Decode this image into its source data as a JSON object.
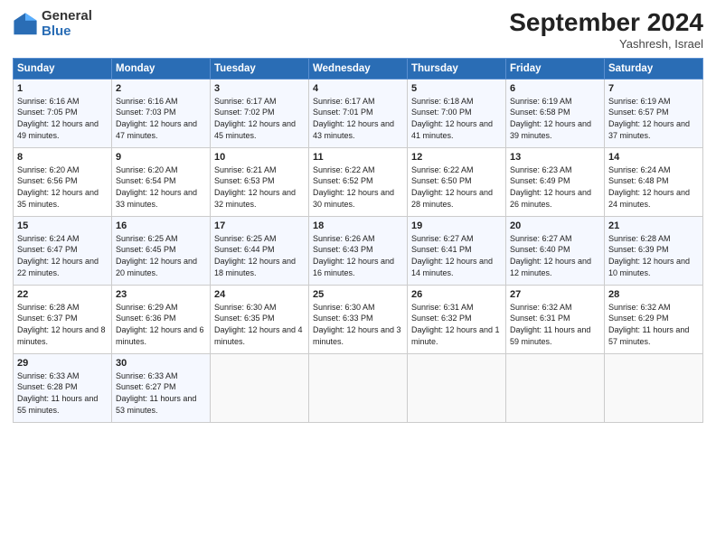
{
  "logo": {
    "general": "General",
    "blue": "Blue"
  },
  "header": {
    "month": "September 2024",
    "location": "Yashresh, Israel"
  },
  "days_of_week": [
    "Sunday",
    "Monday",
    "Tuesday",
    "Wednesday",
    "Thursday",
    "Friday",
    "Saturday"
  ],
  "weeks": [
    [
      {
        "day": "1",
        "sunrise": "6:16 AM",
        "sunset": "7:05 PM",
        "daylight": "12 hours and 49 minutes."
      },
      {
        "day": "2",
        "sunrise": "6:16 AM",
        "sunset": "7:03 PM",
        "daylight": "12 hours and 47 minutes."
      },
      {
        "day": "3",
        "sunrise": "6:17 AM",
        "sunset": "7:02 PM",
        "daylight": "12 hours and 45 minutes."
      },
      {
        "day": "4",
        "sunrise": "6:17 AM",
        "sunset": "7:01 PM",
        "daylight": "12 hours and 43 minutes."
      },
      {
        "day": "5",
        "sunrise": "6:18 AM",
        "sunset": "7:00 PM",
        "daylight": "12 hours and 41 minutes."
      },
      {
        "day": "6",
        "sunrise": "6:19 AM",
        "sunset": "6:58 PM",
        "daylight": "12 hours and 39 minutes."
      },
      {
        "day": "7",
        "sunrise": "6:19 AM",
        "sunset": "6:57 PM",
        "daylight": "12 hours and 37 minutes."
      }
    ],
    [
      {
        "day": "8",
        "sunrise": "6:20 AM",
        "sunset": "6:56 PM",
        "daylight": "12 hours and 35 minutes."
      },
      {
        "day": "9",
        "sunrise": "6:20 AM",
        "sunset": "6:54 PM",
        "daylight": "12 hours and 33 minutes."
      },
      {
        "day": "10",
        "sunrise": "6:21 AM",
        "sunset": "6:53 PM",
        "daylight": "12 hours and 32 minutes."
      },
      {
        "day": "11",
        "sunrise": "6:22 AM",
        "sunset": "6:52 PM",
        "daylight": "12 hours and 30 minutes."
      },
      {
        "day": "12",
        "sunrise": "6:22 AM",
        "sunset": "6:50 PM",
        "daylight": "12 hours and 28 minutes."
      },
      {
        "day": "13",
        "sunrise": "6:23 AM",
        "sunset": "6:49 PM",
        "daylight": "12 hours and 26 minutes."
      },
      {
        "day": "14",
        "sunrise": "6:24 AM",
        "sunset": "6:48 PM",
        "daylight": "12 hours and 24 minutes."
      }
    ],
    [
      {
        "day": "15",
        "sunrise": "6:24 AM",
        "sunset": "6:47 PM",
        "daylight": "12 hours and 22 minutes."
      },
      {
        "day": "16",
        "sunrise": "6:25 AM",
        "sunset": "6:45 PM",
        "daylight": "12 hours and 20 minutes."
      },
      {
        "day": "17",
        "sunrise": "6:25 AM",
        "sunset": "6:44 PM",
        "daylight": "12 hours and 18 minutes."
      },
      {
        "day": "18",
        "sunrise": "6:26 AM",
        "sunset": "6:43 PM",
        "daylight": "12 hours and 16 minutes."
      },
      {
        "day": "19",
        "sunrise": "6:27 AM",
        "sunset": "6:41 PM",
        "daylight": "12 hours and 14 minutes."
      },
      {
        "day": "20",
        "sunrise": "6:27 AM",
        "sunset": "6:40 PM",
        "daylight": "12 hours and 12 minutes."
      },
      {
        "day": "21",
        "sunrise": "6:28 AM",
        "sunset": "6:39 PM",
        "daylight": "12 hours and 10 minutes."
      }
    ],
    [
      {
        "day": "22",
        "sunrise": "6:28 AM",
        "sunset": "6:37 PM",
        "daylight": "12 hours and 8 minutes."
      },
      {
        "day": "23",
        "sunrise": "6:29 AM",
        "sunset": "6:36 PM",
        "daylight": "12 hours and 6 minutes."
      },
      {
        "day": "24",
        "sunrise": "6:30 AM",
        "sunset": "6:35 PM",
        "daylight": "12 hours and 4 minutes."
      },
      {
        "day": "25",
        "sunrise": "6:30 AM",
        "sunset": "6:33 PM",
        "daylight": "12 hours and 3 minutes."
      },
      {
        "day": "26",
        "sunrise": "6:31 AM",
        "sunset": "6:32 PM",
        "daylight": "12 hours and 1 minute."
      },
      {
        "day": "27",
        "sunrise": "6:32 AM",
        "sunset": "6:31 PM",
        "daylight": "11 hours and 59 minutes."
      },
      {
        "day": "28",
        "sunrise": "6:32 AM",
        "sunset": "6:29 PM",
        "daylight": "11 hours and 57 minutes."
      }
    ],
    [
      {
        "day": "29",
        "sunrise": "6:33 AM",
        "sunset": "6:28 PM",
        "daylight": "11 hours and 55 minutes."
      },
      {
        "day": "30",
        "sunrise": "6:33 AM",
        "sunset": "6:27 PM",
        "daylight": "11 hours and 53 minutes."
      },
      null,
      null,
      null,
      null,
      null
    ]
  ]
}
